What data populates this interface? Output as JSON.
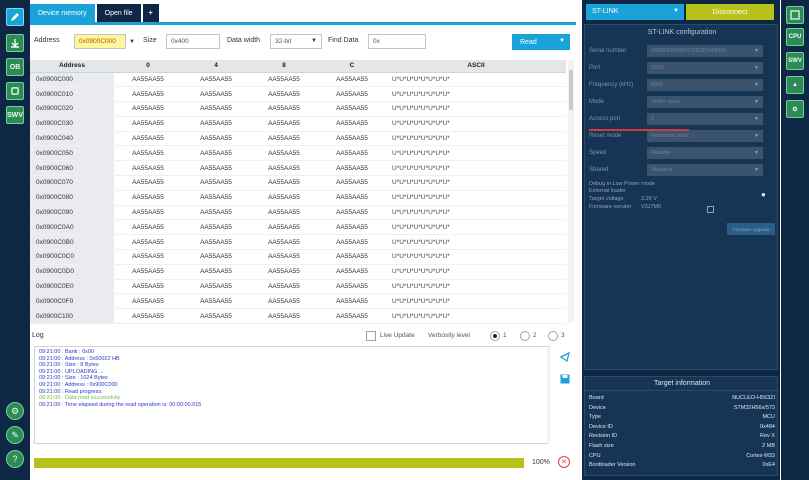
{
  "tabs": [
    {
      "label": "Device memory",
      "active": true
    },
    {
      "label": "Open file",
      "active": false
    },
    {
      "label": "+",
      "active": false
    }
  ],
  "toolbar": {
    "address_label": "Address",
    "address_value": "0x0900C000",
    "size_label": "Size",
    "size_value": "0x400",
    "data_width_label": "Data width",
    "data_width_value": "32-bit",
    "find_data_label": "Find Data",
    "find_data_value": "0x",
    "read_label": "Read"
  },
  "table": {
    "headers": [
      "Address",
      "0",
      "4",
      "8",
      "C",
      "ASCII"
    ],
    "rows": [
      [
        "0x0900C000",
        "AA55AA55",
        "AA55AA55",
        "AA55AA55",
        "AA55AA55",
        "U*U*U*U*U*U*U*U*"
      ],
      [
        "0x0900C010",
        "AA55AA55",
        "AA55AA55",
        "AA55AA55",
        "AA55AA55",
        "U*U*U*U*U*U*U*U*"
      ],
      [
        "0x0900C020",
        "AA55AA55",
        "AA55AA55",
        "AA55AA55",
        "AA55AA55",
        "U*U*U*U*U*U*U*U*"
      ],
      [
        "0x0900C030",
        "AA55AA55",
        "AA55AA55",
        "AA55AA55",
        "AA55AA55",
        "U*U*U*U*U*U*U*U*"
      ],
      [
        "0x0900C040",
        "AA55AA55",
        "AA55AA55",
        "AA55AA55",
        "AA55AA55",
        "U*U*U*U*U*U*U*U*"
      ],
      [
        "0x0900C050",
        "AA55AA55",
        "AA55AA55",
        "AA55AA55",
        "AA55AA55",
        "U*U*U*U*U*U*U*U*"
      ],
      [
        "0x0900C060",
        "AA55AA55",
        "AA55AA55",
        "AA55AA55",
        "AA55AA55",
        "U*U*U*U*U*U*U*U*"
      ],
      [
        "0x0900C070",
        "AA55AA55",
        "AA55AA55",
        "AA55AA55",
        "AA55AA55",
        "U*U*U*U*U*U*U*U*"
      ],
      [
        "0x0900C080",
        "AA55AA55",
        "AA55AA55",
        "AA55AA55",
        "AA55AA55",
        "U*U*U*U*U*U*U*U*"
      ],
      [
        "0x0900C090",
        "AA55AA55",
        "AA55AA55",
        "AA55AA55",
        "AA55AA55",
        "U*U*U*U*U*U*U*U*"
      ],
      [
        "0x0900C0A0",
        "AA55AA55",
        "AA55AA55",
        "AA55AA55",
        "AA55AA55",
        "U*U*U*U*U*U*U*U*"
      ],
      [
        "0x0900C0B0",
        "AA55AA55",
        "AA55AA55",
        "AA55AA55",
        "AA55AA55",
        "U*U*U*U*U*U*U*U*"
      ],
      [
        "0x0900C0C0",
        "AA55AA55",
        "AA55AA55",
        "AA55AA55",
        "AA55AA55",
        "U*U*U*U*U*U*U*U*"
      ],
      [
        "0x0900C0D0",
        "AA55AA55",
        "AA55AA55",
        "AA55AA55",
        "AA55AA55",
        "U*U*U*U*U*U*U*U*"
      ],
      [
        "0x0900C0E0",
        "AA55AA55",
        "AA55AA55",
        "AA55AA55",
        "AA55AA55",
        "U*U*U*U*U*U*U*U*"
      ],
      [
        "0x0900C0F0",
        "AA55AA55",
        "AA55AA55",
        "AA55AA55",
        "AA55AA55",
        "U*U*U*U*U*U*U*U*"
      ],
      [
        "0x0900C100",
        "AA55AA55",
        "AA55AA55",
        "AA55AA55",
        "AA55AA55",
        "U*U*U*U*U*U*U*U*"
      ]
    ]
  },
  "log": {
    "title": "Log",
    "live_update_label": "Live Update",
    "verbosity_label": "Verbosity level",
    "verbosity_options": [
      "1",
      "2",
      "3"
    ],
    "verbosity_selected": "1",
    "lines": [
      {
        "text": "09:21:00 :   Bank         : 0x00",
        "status": "info"
      },
      {
        "text": "09:21:00 :   Address      : 0x50022 HB",
        "status": "info"
      },
      {
        "text": "09:21:00 :   Size         : 8 Bytes",
        "status": "info"
      },
      {
        "text": "09:21:00 : UPLOADING ...",
        "status": "info"
      },
      {
        "text": "09:21:00 :   Size         : 1024 Bytes",
        "status": "info"
      },
      {
        "text": "09:21:00 :   Address      : 0x900C000",
        "status": "info"
      },
      {
        "text": "09:21:00 : Read progress:",
        "status": "info"
      },
      {
        "text": "09:21:00 : Data read successfully",
        "status": "ok"
      },
      {
        "text": "09:21:00 : Time elapsed during the read operation is: 00:00:00.015",
        "status": "info"
      }
    ]
  },
  "progress": {
    "value": 100,
    "label": "100%"
  },
  "probe": {
    "selected": "ST-LINK",
    "disconnect_label": "Disconnect"
  },
  "stlink_config": {
    "title": "ST-LINK configuration",
    "fields": [
      {
        "label": "Serial number",
        "value": "066DFF545654725187144015"
      },
      {
        "label": "Port",
        "value": "SWD"
      },
      {
        "label": "Frequency (kHz)",
        "value": "8000"
      },
      {
        "label": "Mode",
        "value": "Under reset"
      },
      {
        "label": "Access port",
        "value": "0"
      },
      {
        "label": "Reset mode",
        "value": "Hardware reset"
      },
      {
        "label": "Speed",
        "value": "Reliable"
      },
      {
        "label": "Shared",
        "value": "Disabled"
      }
    ],
    "debug_low_power_label": "Debug in Low Power mode",
    "external_loader_label": "External loader",
    "target_voltage_label": "Target voltage",
    "target_voltage_value": "3.26 V",
    "firmware_version_label": "Firmware version",
    "firmware_version_value": "V3J7M6",
    "firmware_upgrade_label": "Firmware upgrade"
  },
  "target_info": {
    "title": "Target information",
    "rows": [
      {
        "label": "Board",
        "value": "NUCLEO-H563ZI"
      },
      {
        "label": "Device",
        "value": "STM32H56x/573"
      },
      {
        "label": "Type",
        "value": "MCU"
      },
      {
        "label": "Device ID",
        "value": "0x484"
      },
      {
        "label": "Revision ID",
        "value": "Rev X"
      },
      {
        "label": "Flash size",
        "value": "2 MB"
      },
      {
        "label": "CPU",
        "value": "Cortex-M33"
      },
      {
        "label": "Bootloader Version",
        "value": "0xE4"
      }
    ]
  },
  "colors": {
    "accent": "#1aa3d9",
    "sidebar": "#0e2744",
    "disconnect": "#b8c11a",
    "log_text": "#2a37c9",
    "log_ok": "#6fbf3a"
  },
  "icons": {
    "left_sidebar": [
      "memory-edit-icon",
      "download-icon",
      "ob-icon",
      "cpu-icon",
      "swv-icon",
      "gear-icon",
      "help-icon"
    ],
    "right_sidebar": [
      "device-icon",
      "cpu-icon",
      "memory-icon",
      "arrow-up-icon",
      "settings-icon"
    ]
  }
}
